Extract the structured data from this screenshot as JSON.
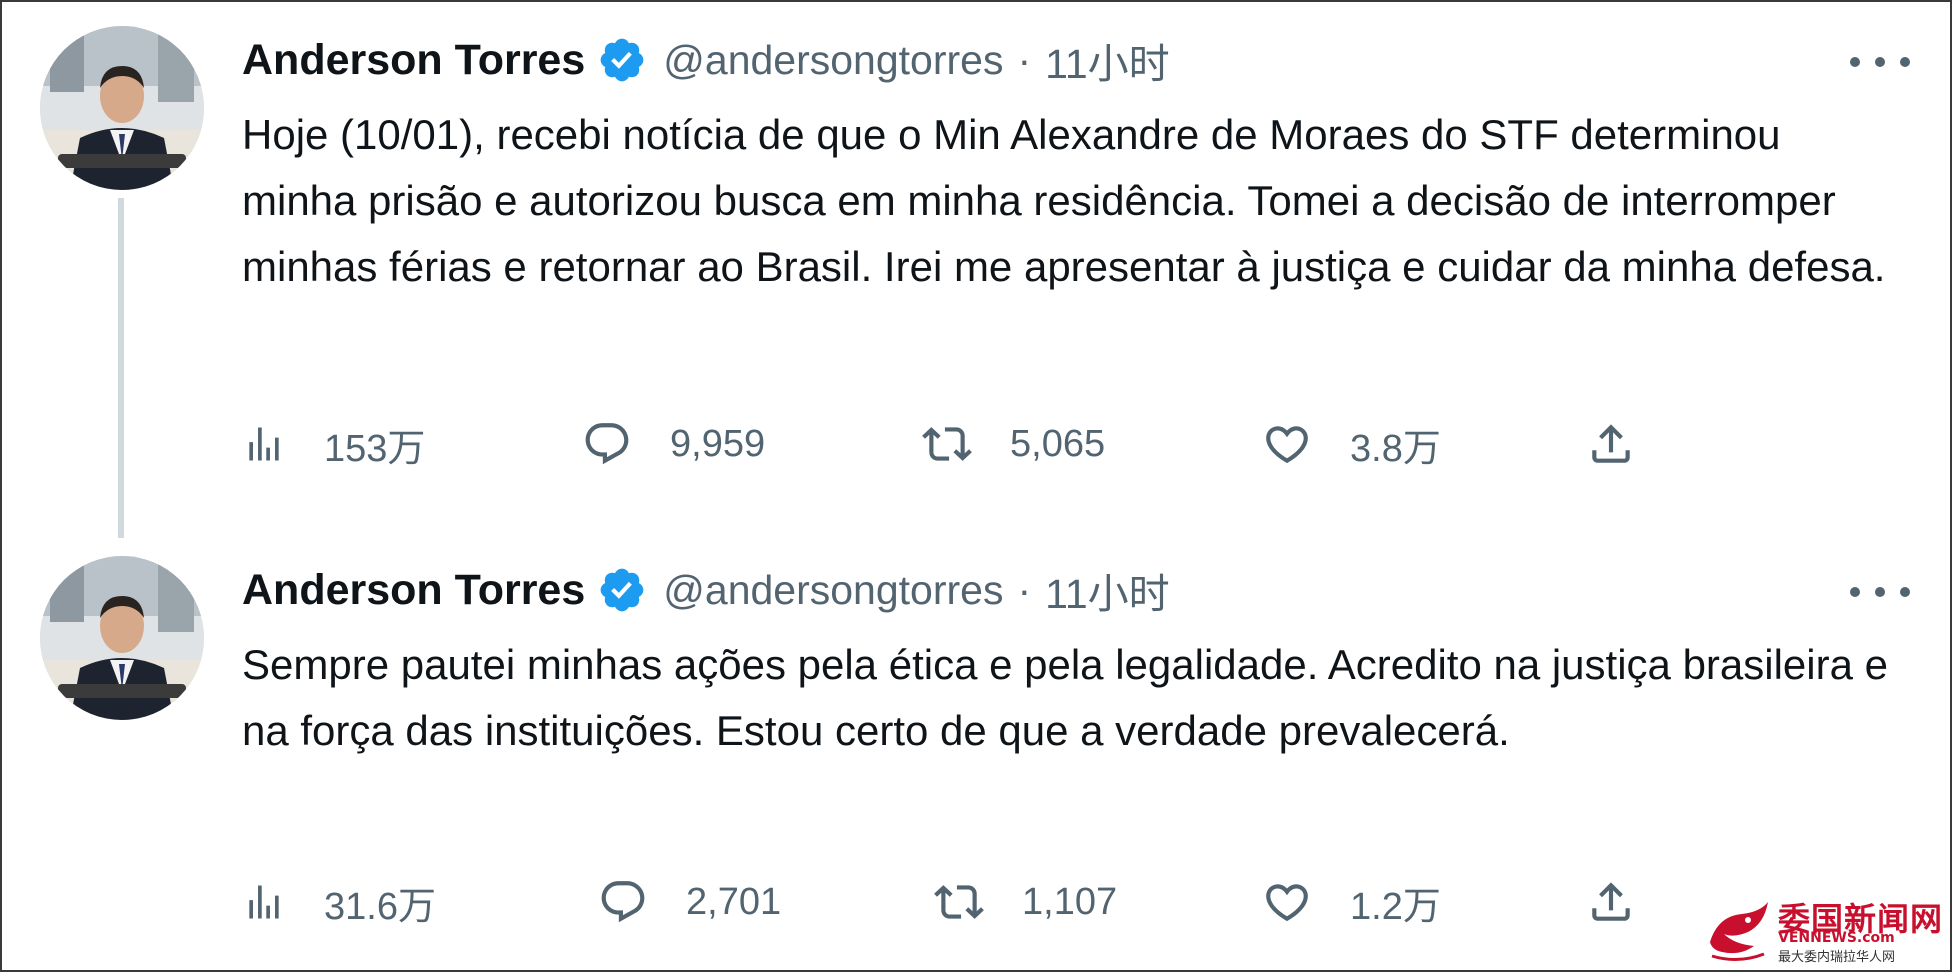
{
  "tweets": [
    {
      "author": {
        "display_name": "Anderson Torres",
        "verified_icon": "verified-badge-icon",
        "handle": "@andersongtorres",
        "separator": "·",
        "time": "11小时"
      },
      "text": "Hoje (10/01), recebi notícia de que o Min Alexandre de Moraes do STF determinou minha prisão e autorizou busca em minha residência. Tomei a decisão de interromper minhas férias e retornar ao Brasil. Irei me apresentar à justiça e cuidar da minha defesa.",
      "stats": {
        "views": "153万",
        "replies": "9,959",
        "retweets": "5,065",
        "likes": "3.8万"
      }
    },
    {
      "author": {
        "display_name": "Anderson Torres",
        "verified_icon": "verified-badge-icon",
        "handle": "@andersongtorres",
        "separator": "·",
        "time": "11小时"
      },
      "text": "Sempre pautei minhas ações pela ética e pela legalidade. Acredito na justiça brasileira e na força das instituições. Estou certo de que a verdade prevalecerá.",
      "stats": {
        "views": "31.6万",
        "replies": "2,701",
        "retweets": "1,107",
        "likes": "1.2万"
      }
    }
  ],
  "icons": {
    "views": "analytics-icon",
    "replies": "reply-icon",
    "retweets": "retweet-icon",
    "likes": "heart-icon",
    "share": "share-icon",
    "more": "more-icon"
  },
  "colors": {
    "text": "#0f1419",
    "secondary": "#536471",
    "verified": "#1d9bf0",
    "thread_line": "#cfd9de",
    "watermark": "#c8102e"
  },
  "watermark": {
    "title": "委国新闻网",
    "domain": "VENNEWS.com",
    "subtitle": "最大委内瑞拉华人网"
  }
}
